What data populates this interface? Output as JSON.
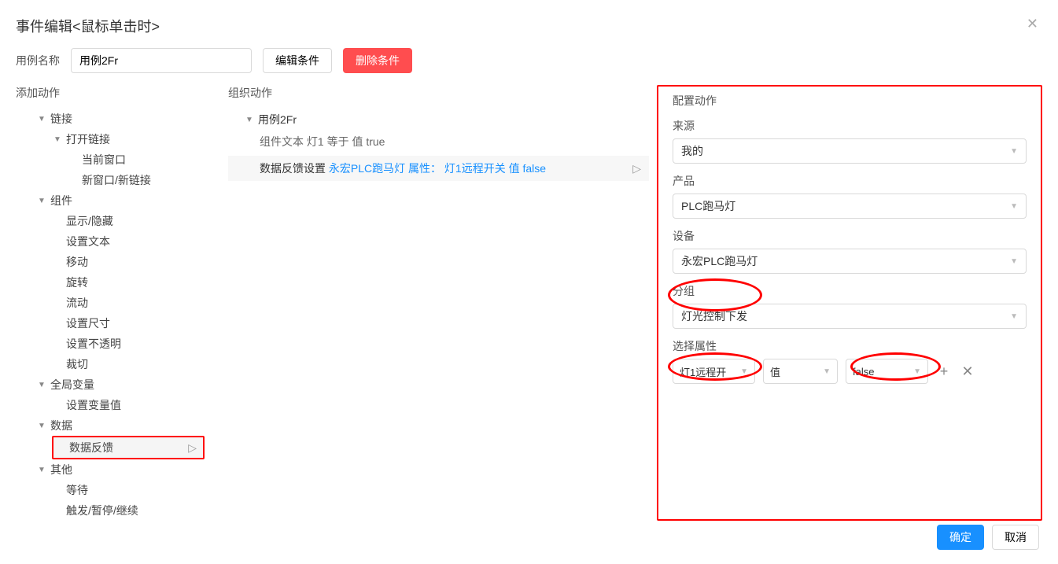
{
  "dialog": {
    "title": "事件编辑<鼠标单击时>"
  },
  "nameRow": {
    "label": "用例名称",
    "value": "用例2Fr",
    "editBtn": "编辑条件",
    "deleteBtn": "删除条件"
  },
  "leftPanel": {
    "title": "添加动作",
    "groups": {
      "link": {
        "label": "链接",
        "open": {
          "label": "打开链接",
          "current": "当前窗口",
          "newWin": "新窗口/新链接"
        }
      },
      "component": {
        "label": "组件",
        "showHide": "显示/隐藏",
        "setText": "设置文本",
        "move": "移动",
        "rotate": "旋转",
        "flow": "流动",
        "setSize": "设置尺寸",
        "setOpacity": "设置不透明",
        "crop": "裁切"
      },
      "globalVar": {
        "label": "全局变量",
        "setVar": "设置变量值"
      },
      "data": {
        "label": "数据",
        "feedback": "数据反馈"
      },
      "other": {
        "label": "其他",
        "wait": "等待",
        "trigger": "触发/暂停/继续"
      }
    }
  },
  "midPanel": {
    "title": "组织动作",
    "caseName": "用例2Fr",
    "condition": "组件文本 灯1 等于 值 true",
    "action": {
      "prefix": "数据反馈设置 ",
      "link": "永宏PLC跑马灯 属性： 灯1远程开关 值 false"
    }
  },
  "rightPanel": {
    "title": "配置动作",
    "source": {
      "label": "来源",
      "value": "我的"
    },
    "product": {
      "label": "产品",
      "value": "PLC跑马灯"
    },
    "device": {
      "label": "设备",
      "value": "永宏PLC跑马灯"
    },
    "group": {
      "label": "分组",
      "value": "灯光控制下发"
    },
    "attr": {
      "label": "选择属性",
      "sel1": "灯1远程开",
      "sel2": "值",
      "sel3": "false"
    }
  },
  "footer": {
    "ok": "确定",
    "cancel": "取消"
  }
}
